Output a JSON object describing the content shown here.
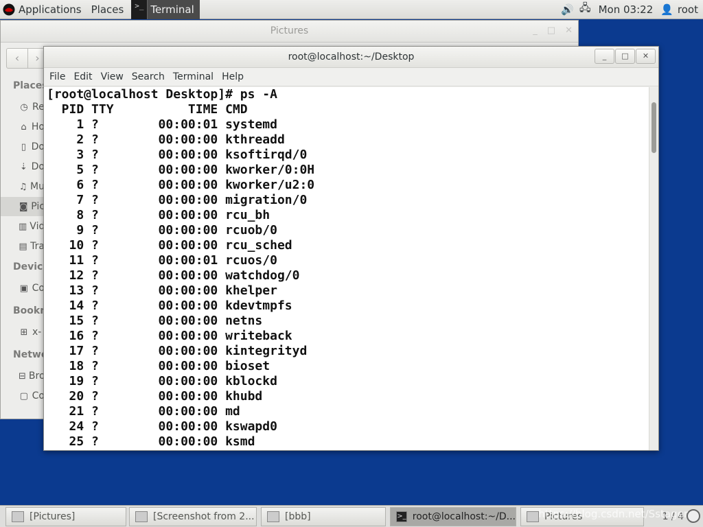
{
  "top_panel": {
    "applications_label": "Applications",
    "places_label": "Places",
    "terminal_label": "Terminal",
    "clock": "Mon 03:22",
    "user": "root",
    "volume_icon": "volume-icon",
    "network_icon": "network-icon",
    "user_icon": "user-icon"
  },
  "nautilus": {
    "title": "Pictures",
    "sidebar": {
      "places_heading": "Places",
      "devices_heading": "Device",
      "bookmarks_heading": "Bookm",
      "network_heading": "Netwo",
      "items": [
        {
          "icon": "clock-icon",
          "label": "Re"
        },
        {
          "icon": "home-icon",
          "label": "Ho"
        },
        {
          "icon": "document-icon",
          "label": "Do"
        },
        {
          "icon": "download-icon",
          "label": "Do"
        },
        {
          "icon": "music-icon",
          "label": "Mu"
        },
        {
          "icon": "camera-icon",
          "label": "Pic"
        },
        {
          "icon": "video-icon",
          "label": "Vid"
        },
        {
          "icon": "trash-icon",
          "label": "Tra"
        },
        {
          "icon": "computer-icon",
          "label": "Co"
        },
        {
          "icon": "network-folder-icon",
          "label": "x-"
        },
        {
          "icon": "browse-network-icon",
          "label": "Bro"
        },
        {
          "icon": "connect-server-icon",
          "label": "Co"
        }
      ]
    }
  },
  "terminal": {
    "title": "root@localhost:~/Desktop",
    "menu": [
      "File",
      "Edit",
      "View",
      "Search",
      "Terminal",
      "Help"
    ],
    "lines": [
      "[root@localhost Desktop]# ps -A",
      "  PID TTY          TIME CMD",
      "    1 ?        00:00:01 systemd",
      "    2 ?        00:00:00 kthreadd",
      "    3 ?        00:00:00 ksoftirqd/0",
      "    5 ?        00:00:00 kworker/0:0H",
      "    6 ?        00:00:00 kworker/u2:0",
      "    7 ?        00:00:00 migration/0",
      "    8 ?        00:00:00 rcu_bh",
      "    9 ?        00:00:00 rcuob/0",
      "   10 ?        00:00:00 rcu_sched",
      "   11 ?        00:00:01 rcuos/0",
      "   12 ?        00:00:00 watchdog/0",
      "   13 ?        00:00:00 khelper",
      "   14 ?        00:00:00 kdevtmpfs",
      "   15 ?        00:00:00 netns",
      "   16 ?        00:00:00 writeback",
      "   17 ?        00:00:00 kintegrityd",
      "   18 ?        00:00:00 bioset",
      "   19 ?        00:00:00 kblockd",
      "   20 ?        00:00:00 khubd",
      "   21 ?        00:00:00 md",
      "   24 ?        00:00:00 kswapd0",
      "   25 ?        00:00:00 ksmd"
    ]
  },
  "taskbar": {
    "tasks": [
      {
        "label": "[Pictures]",
        "icon": "folder-icon"
      },
      {
        "label": "[Screenshot from 2...",
        "icon": "image-viewer-icon"
      },
      {
        "label": "[bbb]",
        "icon": "folder-icon"
      },
      {
        "label": "root@localhost:~/D...",
        "icon": "terminal-icon"
      },
      {
        "label": "Pictures",
        "icon": "folder-icon"
      }
    ],
    "workspace": "1 / 4",
    "watermark": "https://blog.csdn.net/Sstager"
  }
}
